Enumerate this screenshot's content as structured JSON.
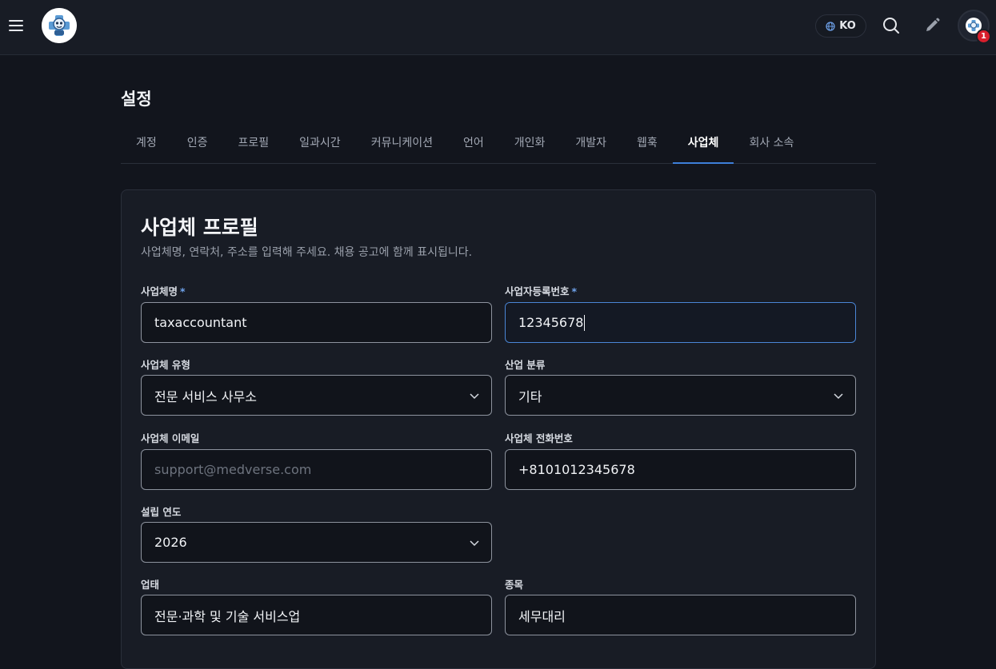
{
  "header": {
    "language": "KO",
    "notification_count": "1"
  },
  "page": {
    "title": "설정"
  },
  "tabs": [
    {
      "label": "계정"
    },
    {
      "label": "인증"
    },
    {
      "label": "프로필"
    },
    {
      "label": "일과시간"
    },
    {
      "label": "커뮤니케이션"
    },
    {
      "label": "언어"
    },
    {
      "label": "개인화"
    },
    {
      "label": "개발자"
    },
    {
      "label": "웹훅"
    },
    {
      "label": "사업체",
      "active": true
    },
    {
      "label": "회사 소속"
    }
  ],
  "card": {
    "title": "사업체 프로필",
    "description": "사업체명, 연락처, 주소를 입력해 주세요. 채용 공고에 함께 표시됩니다."
  },
  "form": {
    "business_name": {
      "label": "사업체명",
      "required": "*",
      "value": "taxaccountant"
    },
    "registration_number": {
      "label": "사업자등록번호",
      "required": "*",
      "value": "12345678"
    },
    "business_type": {
      "label": "사업체 유형",
      "value": "전문 서비스 사무소"
    },
    "industry": {
      "label": "산업 분류",
      "value": "기타"
    },
    "email": {
      "label": "사업체 이메일",
      "value": "",
      "placeholder": "support@medverse.com"
    },
    "phone": {
      "label": "사업체 전화번호",
      "value": "+8101012345678"
    },
    "founded_year": {
      "label": "설립 연도",
      "value": "2026"
    },
    "business_category": {
      "label": "업태",
      "value": "전문·과학 및 기술 서비스업"
    },
    "business_item": {
      "label": "종목",
      "value": "세무대리"
    }
  },
  "colors": {
    "accent": "#3d7fd9",
    "required": "#6fa3ec",
    "badge": "#d81e2c",
    "background": "#12151d",
    "surface": "#181c25"
  },
  "icons": {
    "menu": "hamburger-menu-icon",
    "logo": "medical-mascot-logo",
    "language": "globe-icon",
    "search": "search-icon",
    "edit": "pencil-icon",
    "select": "chevron-down-icon"
  }
}
